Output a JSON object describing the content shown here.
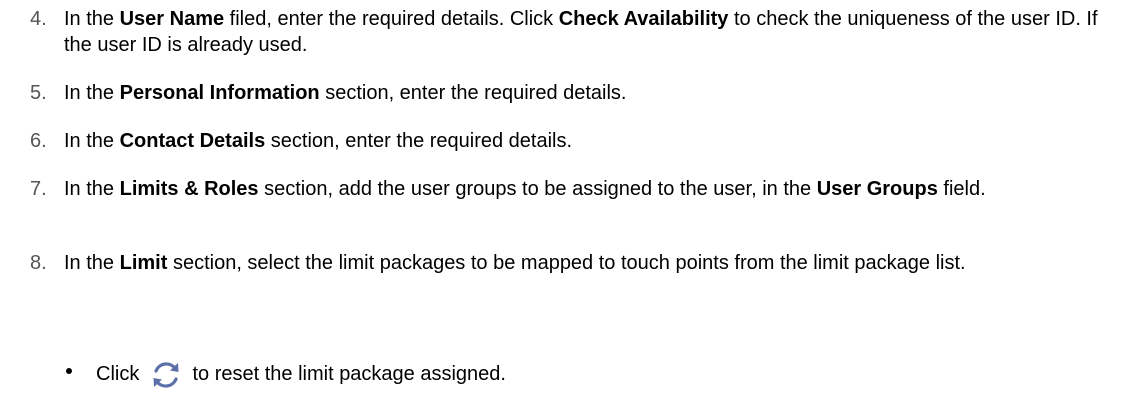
{
  "steps": [
    {
      "num": "4.",
      "parts": [
        "In the ",
        "User Name",
        " filed, enter the required details. Click ",
        "Check Availability",
        " to check the uniqueness of the user ID. If the user ID is already used."
      ]
    },
    {
      "num": "5.",
      "parts": [
        "In the ",
        "Personal Information",
        " section, enter the required details."
      ]
    },
    {
      "num": "6.",
      "parts": [
        "In the ",
        "Contact Details",
        " section, enter the required details."
      ]
    },
    {
      "num": "7.",
      "parts": [
        "In the ",
        "Limits & Roles",
        " section, add the user groups to be assigned to the user, in the ",
        "User Groups",
        " field."
      ]
    },
    {
      "num": "8.",
      "parts": [
        "In the ",
        "Limit",
        " section, select the limit packages to be mapped to touch points from the limit package list."
      ]
    }
  ],
  "bullet": {
    "before": "Click",
    "icon": "refresh-icon",
    "after": "to reset the limit package assigned."
  },
  "colors": {
    "number": "#555555",
    "text": "#000000",
    "icon": "#5b6fa8"
  }
}
